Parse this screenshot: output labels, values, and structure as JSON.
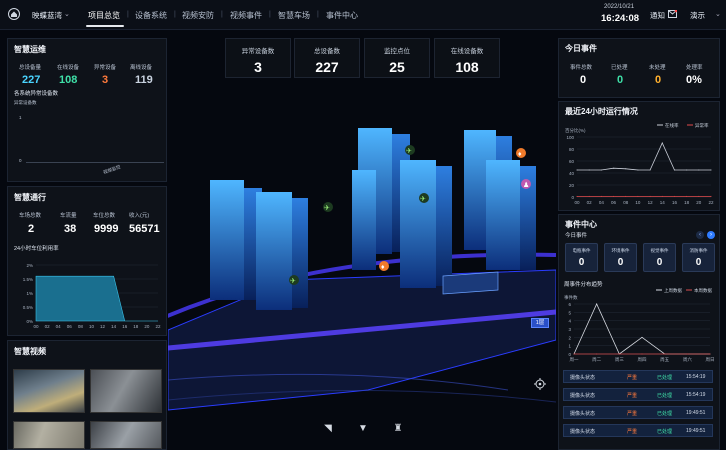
{
  "header": {
    "project": "映蝶蓝湾",
    "tabs": [
      "项目总览",
      "设备系统",
      "视频安防",
      "视频事件",
      "智慧车场",
      "事件中心"
    ],
    "active_tab": "项目总览",
    "date": "2022/10/21",
    "time": "16:24:08",
    "notice": "通知",
    "demo": "演示"
  },
  "ops": {
    "title": "智慧运维",
    "stats": [
      {
        "label": "总设备量",
        "value": "227",
        "color": "#4ad4ff"
      },
      {
        "label": "在线设备",
        "value": "108",
        "color": "#3fe0a8"
      },
      {
        "label": "异常设备",
        "value": "3",
        "color": "#ff7a3c"
      },
      {
        "label": "离线设备",
        "value": "119",
        "color": "#c9d3e0"
      }
    ],
    "subtitle": "各系统异常设备数",
    "axis_label": "异常设备数",
    "y_zero": "0",
    "y_one": "1",
    "x_label": "视频监控"
  },
  "traffic": {
    "title": "智慧通行",
    "stats": [
      {
        "label": "车场总数",
        "value": "2"
      },
      {
        "label": "车流量",
        "value": "38"
      },
      {
        "label": "车位总数",
        "value": "9999"
      },
      {
        "label": "收入(元)",
        "value": "56571"
      }
    ],
    "subtitle": "24小时车位利用率"
  },
  "chart_data": [
    {
      "type": "area",
      "title": "24小时车位利用率",
      "x": [
        "00",
        "02",
        "04",
        "06",
        "08",
        "10",
        "12",
        "14",
        "16",
        "18",
        "20",
        "22"
      ],
      "y_ticks": [
        "2%",
        "1.5%",
        "1%",
        "0.5%",
        "0%"
      ],
      "ylim": [
        0,
        2
      ],
      "values": [
        1.6,
        1.6,
        1.6,
        1.6,
        1.6,
        1.6,
        1.6,
        1.6,
        0,
        0,
        0,
        0
      ]
    },
    {
      "type": "line",
      "title": "最近24小时运行情况",
      "ylabel": "百分比(%)",
      "x": [
        "00",
        "02",
        "04",
        "06",
        "08",
        "10",
        "12",
        "14",
        "16",
        "18",
        "20",
        "22"
      ],
      "y_ticks": [
        "100",
        "80",
        "60",
        "40",
        "20",
        "0"
      ],
      "ylim": [
        0,
        100
      ],
      "series": [
        {
          "name": "在线率",
          "color": "#c9ced8",
          "values": [
            45,
            45,
            45,
            48,
            47,
            45,
            45,
            90,
            45,
            45,
            45,
            45
          ]
        },
        {
          "name": "异常率",
          "color": "#e24a4a",
          "values": [
            1,
            1,
            1,
            1,
            1,
            1,
            1,
            1,
            1,
            1,
            1,
            1
          ]
        }
      ],
      "legend": "top-right"
    },
    {
      "type": "line",
      "title": "周事件分布趋势",
      "ylabel": "事件数",
      "x": [
        "周一",
        "周二",
        "周三",
        "周四",
        "周五",
        "周六",
        "周日"
      ],
      "y_ticks": [
        "6",
        "5",
        "4",
        "3",
        "2",
        "1",
        "0"
      ],
      "ylim": [
        0,
        6
      ],
      "series": [
        {
          "name": "上周数据",
          "color": "#d7dbe2",
          "values": [
            0,
            6,
            0,
            2,
            0,
            0,
            0
          ]
        },
        {
          "name": "本周数据",
          "color": "#d94f4f",
          "values": [
            0,
            0,
            0,
            0,
            0,
            0,
            0
          ]
        }
      ],
      "legend": "top-right"
    }
  ],
  "video": {
    "title": "智慧视频"
  },
  "center": {
    "stats": [
      {
        "label": "异常设备数",
        "value": "3"
      },
      {
        "label": "总设备数",
        "value": "227"
      },
      {
        "label": "监控点位",
        "value": "25"
      },
      {
        "label": "在线设备数",
        "value": "108"
      }
    ],
    "floor_label": "1层"
  },
  "today": {
    "title": "今日事件",
    "stats": [
      {
        "label": "事件总数",
        "value": "0",
        "color": "#ffffff"
      },
      {
        "label": "已处理",
        "value": "0",
        "color": "#3fe0a8"
      },
      {
        "label": "未处理",
        "value": "0",
        "color": "#ffb02e"
      },
      {
        "label": "处理率",
        "value": "0%",
        "color": "#ffffff"
      }
    ]
  },
  "run": {
    "title": "最近24小时运行情况"
  },
  "events": {
    "title": "事件中心",
    "today_label": "今日事件",
    "cards": [
      {
        "label": "电瓶事件",
        "value": "0"
      },
      {
        "label": "环境事件",
        "value": "0"
      },
      {
        "label": "视觉事件",
        "value": "0"
      },
      {
        "label": "消防事件",
        "value": "0"
      }
    ],
    "trend_title": "周事件分布趋势",
    "rows": [
      {
        "name": "摄像头状态",
        "level": "严重",
        "status": "已处理",
        "time": "15:54:19"
      },
      {
        "name": "摄像头状态",
        "level": "严重",
        "status": "已处理",
        "time": "15:54:19"
      },
      {
        "name": "摄像头状态",
        "level": "严重",
        "status": "已处理",
        "time": "19:49:51"
      },
      {
        "name": "摄像头状态",
        "level": "严重",
        "status": "已处理",
        "time": "19:49:51"
      }
    ]
  }
}
